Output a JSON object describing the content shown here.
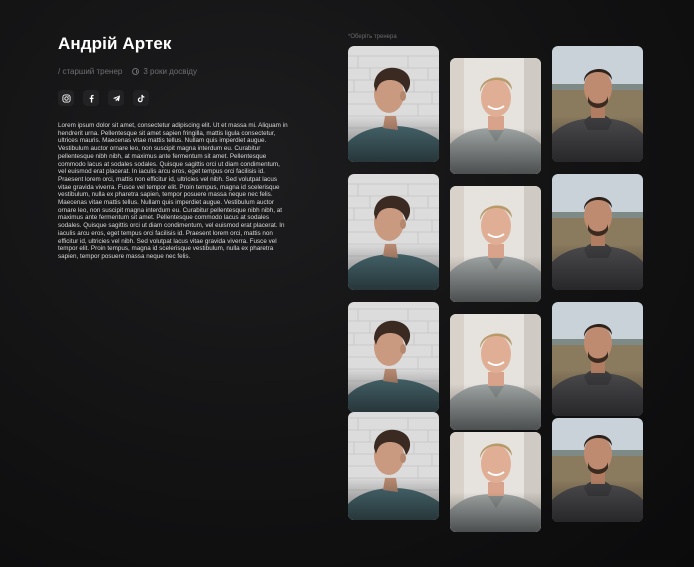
{
  "trainer": {
    "name": "Андрій Артек",
    "role": "/ старший тренер",
    "experience": "3 роки досвіду",
    "bio": "Lorem ipsum dolor sit amet, consectetur adipiscing elit. Ut et massa mi. Aliquam in\nhendrerit urna. Pellentesque sit amet sapien fringilla, mattis ligula consectetur,\nultrices mauris. Maecenas vitae mattis tellus. Nullam quis imperdiet augue.\nVestibulum auctor ornare leo, non suscipit magna interdum eu. Curabitur\npellentesque nibh nibh, at maximus ante fermentum sit amet. Pellentesque\ncommodo lacus at sodales sodales. Quisque sagittis orci ut diam condimentum,\nvel euismod erat placerat. In iaculis arcu eros, eget tempus orci facilisis id.\nPraesent lorem orci, mattis non efficitur id, ultricies vel nibh. Sed volutpat lacus\nvitae gravida viverra. Fusce vel tempor elit. Proin tempus, magna id scelerisque\nvestibulum, nulla ex pharetra sapien, tempor posuere massa neque nec felis.\nMaecenas vitae mattis tellus. Nullam quis imperdiet augue. Vestibulum auctor\nornare leo, non suscipit magna interdum eu. Curabitur pellentesque nibh nibh, at\nmaximus ante fermentum sit amet. Pellentesque commodo lacus at sodales\nsodales. Quisque sagittis orci ut diam condimentum, vel euismod erat placerat. In\niaculis arcu eros, eget tempus orci facilisis id. Praesent lorem orci, mattis non\nefficitur id, ultricies vel nibh. Sed volutpat lacus vitae gravida viverra. Fusce vel\ntempor elit. Proin tempus, magna id scelerisque vestibulum, nulla ex pharetra\nsapien, tempor posuere massa neque nec felis."
  },
  "socials": [
    {
      "icon": "instagram-icon"
    },
    {
      "icon": "facebook-icon"
    },
    {
      "icon": "telegram-icon"
    },
    {
      "icon": "tiktok-icon"
    }
  ],
  "gallery": {
    "caption": "*Оберіть тренера",
    "columns": [
      {
        "photo": "man-brick-wall-profile-photo",
        "count": 4
      },
      {
        "photo": "smiling-man-grey-polo-photo",
        "count": 4
      },
      {
        "photo": "man-hoodie-field-photo",
        "count": 4
      }
    ]
  },
  "colors": {
    "background": "#121213",
    "muted_text": "#6f6f73",
    "social_bg": "#222224"
  }
}
